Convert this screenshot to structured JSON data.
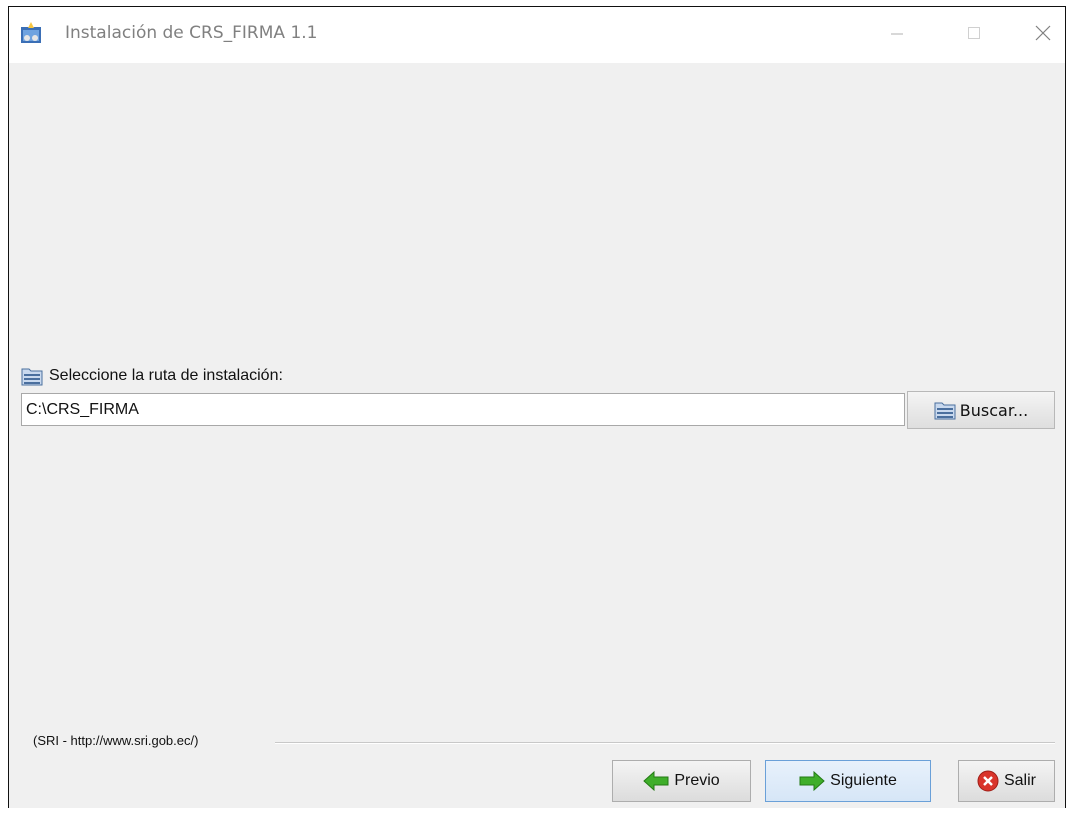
{
  "window": {
    "title": "Instalación de CRS_FIRMA 1.1",
    "controls": {
      "minimize": "minimize-icon",
      "maximize": "maximize-icon",
      "close": "close-icon"
    }
  },
  "install_path": {
    "label": "Seleccione la ruta de instalación:",
    "value": "C:\\CRS_FIRMA",
    "browse_label": "Buscar..."
  },
  "footer": {
    "text": "(SRI - http://www.sri.gob.ec/)"
  },
  "buttons": {
    "previous": "Previo",
    "next": "Siguiente",
    "exit": "Salir"
  },
  "colors": {
    "window_bg": "#f0f0f0",
    "titlebar_bg": "#ffffff",
    "next_arrow": "#3fae2a",
    "exit_icon": "#d9342b"
  }
}
